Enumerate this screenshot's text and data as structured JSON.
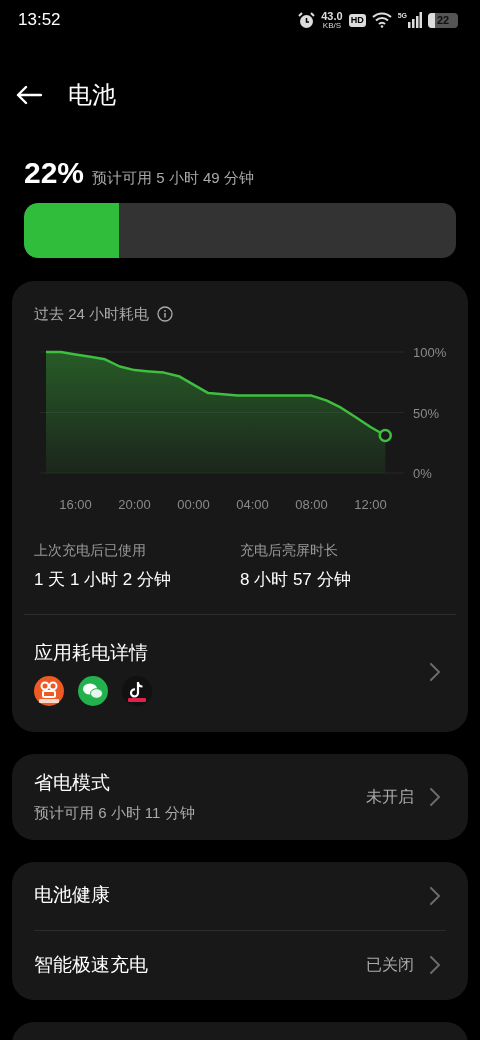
{
  "status_bar": {
    "time": "13:52",
    "net_speed": "43.0",
    "net_unit": "KB/S",
    "hd": "HD",
    "network": "5G",
    "battery": "22"
  },
  "header": {
    "title": "电池"
  },
  "battery": {
    "percent": "22%",
    "estimate": "预计可用 5 小时 49 分钟",
    "level": 0.22
  },
  "usage_card": {
    "title": "过去 24 小时耗电",
    "chart_data": {
      "type": "area",
      "categories": [
        null,
        null,
        "16:00",
        null,
        null,
        null,
        "20:00",
        null,
        null,
        null,
        "00:00",
        null,
        null,
        null,
        "04:00",
        null,
        null,
        null,
        "08:00",
        null,
        null,
        null,
        "12:00",
        null
      ],
      "series": [
        {
          "color": "#3fbf3f",
          "values": [
            100,
            100,
            98,
            96,
            94,
            88,
            85,
            84,
            83,
            80,
            73,
            66,
            65,
            64,
            64,
            64,
            64,
            64,
            64,
            60,
            54,
            46,
            38,
            31
          ]
        }
      ],
      "ylim": [
        0,
        100
      ],
      "yticks": [
        {
          "value": 100,
          "label": "100%"
        },
        {
          "value": 50,
          "label": "50%"
        },
        {
          "value": 0,
          "label": "0%"
        }
      ]
    },
    "stats": [
      {
        "label": "上次充电后已使用",
        "value": "1 天 1 小时 2 分钟"
      },
      {
        "label": "充电后亮屏时长",
        "value": "8 小时 57 分钟"
      }
    ],
    "app_details": {
      "title": "应用耗电详情"
    }
  },
  "power_saving": {
    "title": "省电模式",
    "subtitle": "预计可用 6 小时 11 分钟",
    "status": "未开启"
  },
  "settings": [
    {
      "label": "电池健康"
    },
    {
      "label": "智能极速充电",
      "status": "已关闭"
    }
  ]
}
